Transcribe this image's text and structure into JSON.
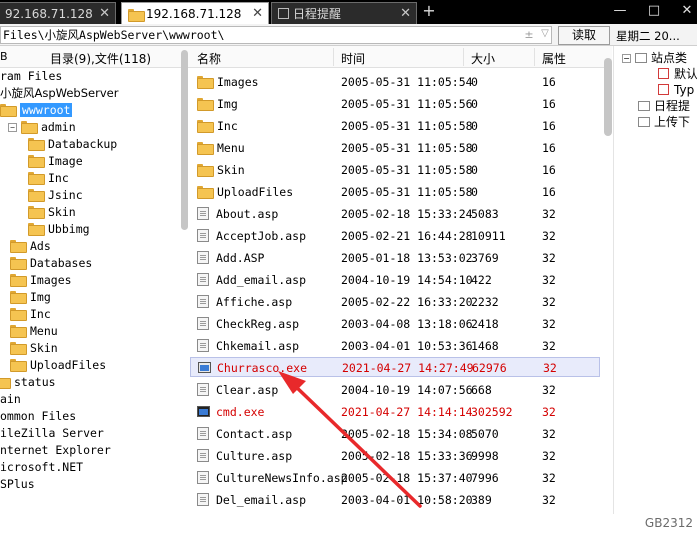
{
  "tabs": [
    {
      "label": "92.168.71.128"
    },
    {
      "label": "192.168.71.128"
    },
    {
      "label": "日程提醒"
    }
  ],
  "address": {
    "value": "Files\\小旋风AspWebServer\\wwwroot\\",
    "read_label": "读取",
    "date_label": "星期二 20..."
  },
  "tree_header": {
    "left": "B",
    "summary": "目录(9),文件(118)"
  },
  "tree": [
    {
      "label": "ram Files"
    },
    {
      "label": "小旋风AspWebServer"
    },
    {
      "label": "wwwroot"
    },
    {
      "label": "admin"
    },
    {
      "label": "Databackup"
    },
    {
      "label": "Image"
    },
    {
      "label": "Inc"
    },
    {
      "label": "Jsinc"
    },
    {
      "label": "Skin"
    },
    {
      "label": "Ubbimg"
    },
    {
      "label": "Ads"
    },
    {
      "label": "Databases"
    },
    {
      "label": "Images"
    },
    {
      "label": "Img"
    },
    {
      "label": "Inc"
    },
    {
      "label": "Menu"
    },
    {
      "label": "Skin"
    },
    {
      "label": "UploadFiles"
    },
    {
      "label": "status"
    },
    {
      "label": "ain"
    },
    {
      "label": "ommon Files"
    },
    {
      "label": "ileZilla Server"
    },
    {
      "label": "nternet Explorer"
    },
    {
      "label": "icrosoft.NET"
    },
    {
      "label": "SPlus"
    }
  ],
  "columns": {
    "name": "名称",
    "time": "时间",
    "size": "大小",
    "attr": "属性"
  },
  "files": [
    {
      "name": "Images",
      "time": "2005-05-31 11:05:54",
      "size": "0",
      "attr": "16",
      "type": "folder"
    },
    {
      "name": "Img",
      "time": "2005-05-31 11:05:56",
      "size": "0",
      "attr": "16",
      "type": "folder"
    },
    {
      "name": "Inc",
      "time": "2005-05-31 11:05:58",
      "size": "0",
      "attr": "16",
      "type": "folder"
    },
    {
      "name": "Menu",
      "time": "2005-05-31 11:05:58",
      "size": "0",
      "attr": "16",
      "type": "folder"
    },
    {
      "name": "Skin",
      "time": "2005-05-31 11:05:58",
      "size": "0",
      "attr": "16",
      "type": "folder"
    },
    {
      "name": "UploadFiles",
      "time": "2005-05-31 11:05:58",
      "size": "0",
      "attr": "16",
      "type": "folder"
    },
    {
      "name": "About.asp",
      "time": "2005-02-18 15:33:24",
      "size": "5083",
      "attr": "32",
      "type": "file"
    },
    {
      "name": "AcceptJob.asp",
      "time": "2005-02-21 16:44:28",
      "size": "10911",
      "attr": "32",
      "type": "file"
    },
    {
      "name": "Add.ASP",
      "time": "2005-01-18 13:53:02",
      "size": "3769",
      "attr": "32",
      "type": "file"
    },
    {
      "name": "Add_email.asp",
      "time": "2004-10-19 14:54:10",
      "size": "422",
      "attr": "32",
      "type": "file"
    },
    {
      "name": "Affiche.asp",
      "time": "2005-02-22 16:33:20",
      "size": "2232",
      "attr": "32",
      "type": "file"
    },
    {
      "name": "CheckReg.asp",
      "time": "2003-04-08 13:18:06",
      "size": "2418",
      "attr": "32",
      "type": "file"
    },
    {
      "name": "Chkemail.asp",
      "time": "2003-04-01 10:53:36",
      "size": "1468",
      "attr": "32",
      "type": "file"
    },
    {
      "name": "Churrasco.exe",
      "time": "2021-04-27 14:27:49",
      "size": "62976",
      "attr": "32",
      "type": "exe"
    },
    {
      "name": "Clear.asp",
      "time": "2004-10-19 14:07:56",
      "size": "668",
      "attr": "32",
      "type": "file"
    },
    {
      "name": "cmd.exe",
      "time": "2021-04-27 14:14:14",
      "size": "302592",
      "attr": "32",
      "type": "exe"
    },
    {
      "name": "Contact.asp",
      "time": "2005-02-18 15:34:08",
      "size": "5070",
      "attr": "32",
      "type": "file"
    },
    {
      "name": "Culture.asp",
      "time": "2005-02-18 15:33:36",
      "size": "9998",
      "attr": "32",
      "type": "file"
    },
    {
      "name": "CultureNewsInfo.asp",
      "time": "2005-02-18 15:37:40",
      "size": "7996",
      "attr": "32",
      "type": "file"
    },
    {
      "name": "Del_email.asp",
      "time": "2003-04-01 10:58:20",
      "size": "389",
      "attr": "32",
      "type": "file"
    }
  ],
  "highlight_color": "#d40000",
  "right_panel": [
    {
      "label": "站点类"
    },
    {
      "label": "默认"
    },
    {
      "label": "Typ"
    },
    {
      "label": "日程提"
    },
    {
      "label": "上传下"
    }
  ],
  "watermark": "GB2312"
}
